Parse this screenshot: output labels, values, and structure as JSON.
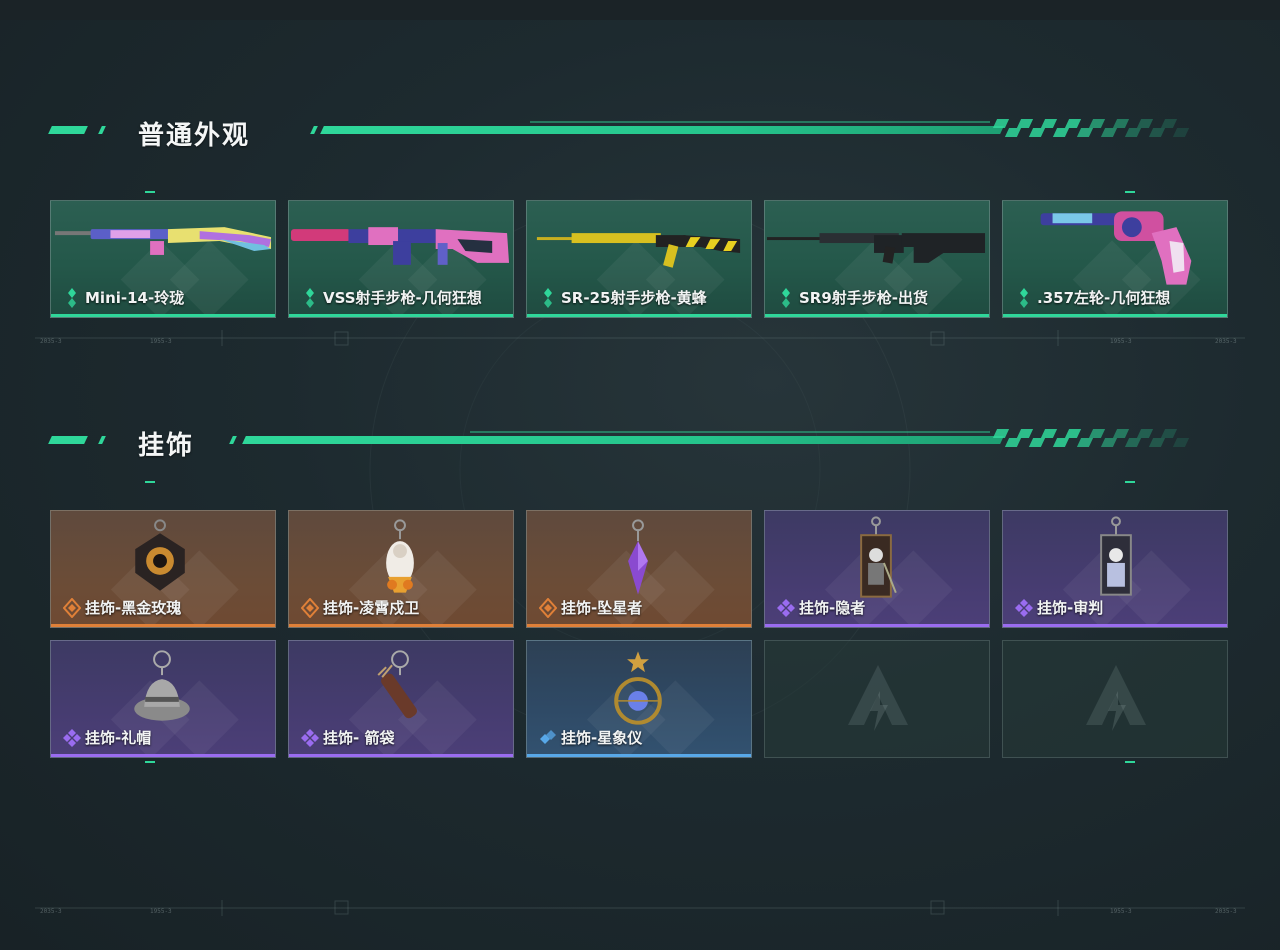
{
  "sections": [
    {
      "title": "普通外观"
    },
    {
      "title": "挂饰"
    }
  ],
  "skins": [
    {
      "name": "Mini-14-玲珑",
      "rarity": "green",
      "icon": "rifle-mini14-icon"
    },
    {
      "name": "VSS射手步枪-几何狂想",
      "rarity": "green",
      "icon": "rifle-vss-icon"
    },
    {
      "name": "SR-25射手步枪-黄蜂",
      "rarity": "green",
      "icon": "rifle-sr25-icon"
    },
    {
      "name": "SR9射手步枪-出货",
      "rarity": "green",
      "icon": "rifle-sr9-icon"
    },
    {
      "name": ".357左轮-几何狂想",
      "rarity": "green",
      "icon": "revolver-357-icon"
    }
  ],
  "charms": [
    {
      "name": "挂饰-黑金玫瑰",
      "rarity": "orange",
      "icon": "charm-rose-icon"
    },
    {
      "name": "挂饰-凌霄戍卫",
      "rarity": "orange",
      "icon": "charm-guard-icon"
    },
    {
      "name": "挂饰-坠星者",
      "rarity": "orange",
      "icon": "charm-crystal-icon"
    },
    {
      "name": "挂饰-隐者",
      "rarity": "purple",
      "icon": "charm-tarot-hermit-icon"
    },
    {
      "name": "挂饰-审判",
      "rarity": "purple",
      "icon": "charm-tarot-judgement-icon"
    },
    {
      "name": "挂饰-礼帽",
      "rarity": "purple",
      "icon": "charm-hat-icon"
    },
    {
      "name": "挂饰- 箭袋",
      "rarity": "purple",
      "icon": "charm-quiver-icon"
    },
    {
      "name": "挂饰-星象仪",
      "rarity": "blue",
      "icon": "charm-astrolabe-icon"
    },
    {
      "name": "",
      "rarity": "empty",
      "icon": "empty-slot-logo-icon"
    },
    {
      "name": "",
      "rarity": "empty",
      "icon": "empty-slot-logo-icon"
    }
  ],
  "colors": {
    "accent": "#2fd79a",
    "green": "#2fd79a",
    "orange": "#e08038",
    "purple": "#9a6cf0",
    "blue": "#58a8e8"
  }
}
